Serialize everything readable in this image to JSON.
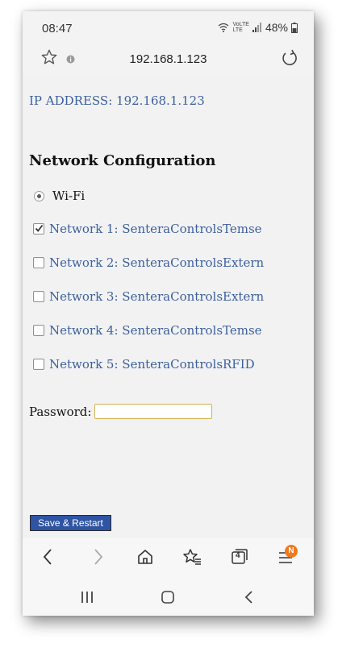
{
  "status_bar": {
    "time": "08:47",
    "battery": "48%",
    "network_top": "VoLTE",
    "network_bottom": "LTE"
  },
  "address_bar": {
    "url": "192.168.1.123"
  },
  "page": {
    "ip_address_line": "IP ADDRESS: 192.168.1.123",
    "section_title": "Network Configuration",
    "mode_label": "Wi-Fi",
    "networks": [
      {
        "label": "Network 1: SenteraControlsTemse",
        "checked": true
      },
      {
        "label": "Network 2: SenteraControlsExtern",
        "checked": false
      },
      {
        "label": "Network 3: SenteraControlsExtern",
        "checked": false
      },
      {
        "label": "Network 4: SenteraControlsTemse",
        "checked": false
      },
      {
        "label": "Network 5: SenteraControlsRFID",
        "checked": false
      }
    ],
    "password_label": "Password:",
    "password_value": "",
    "save_label": "Save & Restart"
  },
  "toolbar": {
    "tabs_count": "4",
    "menu_badge": "N"
  },
  "colors": {
    "link_blue": "#3b5f9e",
    "button_blue": "#2f54a3",
    "input_border": "#d7b24a",
    "badge_orange": "#f07a1e"
  }
}
